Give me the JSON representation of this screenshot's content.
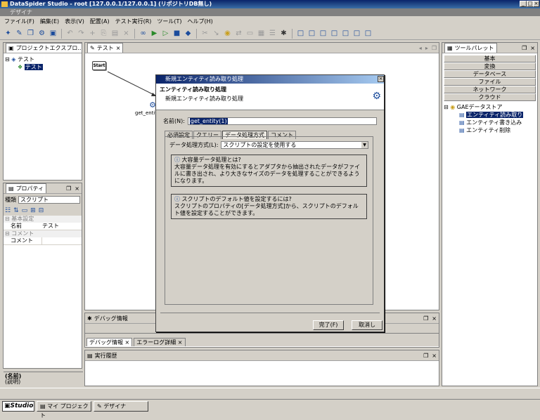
{
  "window": {
    "title": "DataSpider Studio - root [127.0.0.1/127.0.0.1] (リポジトリDB無し)",
    "subtitle": "デザイナ",
    "min": "_",
    "max": "□",
    "close": "×"
  },
  "menu": [
    "ファイル(F)",
    "編集(E)",
    "表示(V)",
    "配置(A)",
    "テスト実行(R)",
    "ツール(T)",
    "ヘルプ(H)"
  ],
  "explorer": {
    "title": "プロジェクトエクスプロ...",
    "root": "テスト",
    "child": "テスト"
  },
  "properties": {
    "title": "プロパティ",
    "kind_label": "種類",
    "kind_value": "スクリプト",
    "section_basic": "基本設定",
    "name_label": "名前",
    "name_value": "テスト",
    "section_comment": "コメント",
    "comment_label": "コメント",
    "footer_name": "(名前)",
    "footer_desc": "(説明)"
  },
  "editor": {
    "tab": "テスト",
    "start_label": "Start",
    "entity_label": "get_entity"
  },
  "debug": {
    "title": "デバッグ情報",
    "tab1": "デバッグ情報",
    "tab2": "エラーログ詳細"
  },
  "history": {
    "title": "実行履歴"
  },
  "palette": {
    "title": "ツールパレット",
    "categories": [
      "基本",
      "変換",
      "データベース",
      "ファイル",
      "ネットワーク",
      "クラウド"
    ],
    "tree_root": "GAEデータストア",
    "items": [
      "エンティティ読み取り",
      "エンティティ書き込み",
      "エンティティ削除"
    ]
  },
  "dialog": {
    "title": "新規エンティティ読み取り処理",
    "header": "エンティティ読み取り処理",
    "subheader": "新規エンティティ読み取り処理",
    "name_label": "名前(N):",
    "name_value": "get_entity(1)",
    "tabs": [
      "必須設定",
      "クエリー",
      "データ処理方式",
      "コメント"
    ],
    "method_label": "データ処理方式(L):",
    "method_value": "スクリプトの設定を使用する",
    "info1_title": "大容量データ処理とは?",
    "info1_text": "大容量データ処理を有効にするとアダプタから抽出されたデータがファイルに書き出され、より大きなサイズのデータを処理することができるようになります。",
    "info2_title": "スクリプトのデフォルト値を設定するには?",
    "info2_text": "スクリプトのプロパティの[データ処理方式]から、スクリプトのデフォルト値を設定することができます。",
    "ok": "完了(F)",
    "cancel": "取消し"
  },
  "statusbar": {
    "studio": "Studio",
    "project": "マイ プロジェクト",
    "designer": "デザイナ"
  }
}
